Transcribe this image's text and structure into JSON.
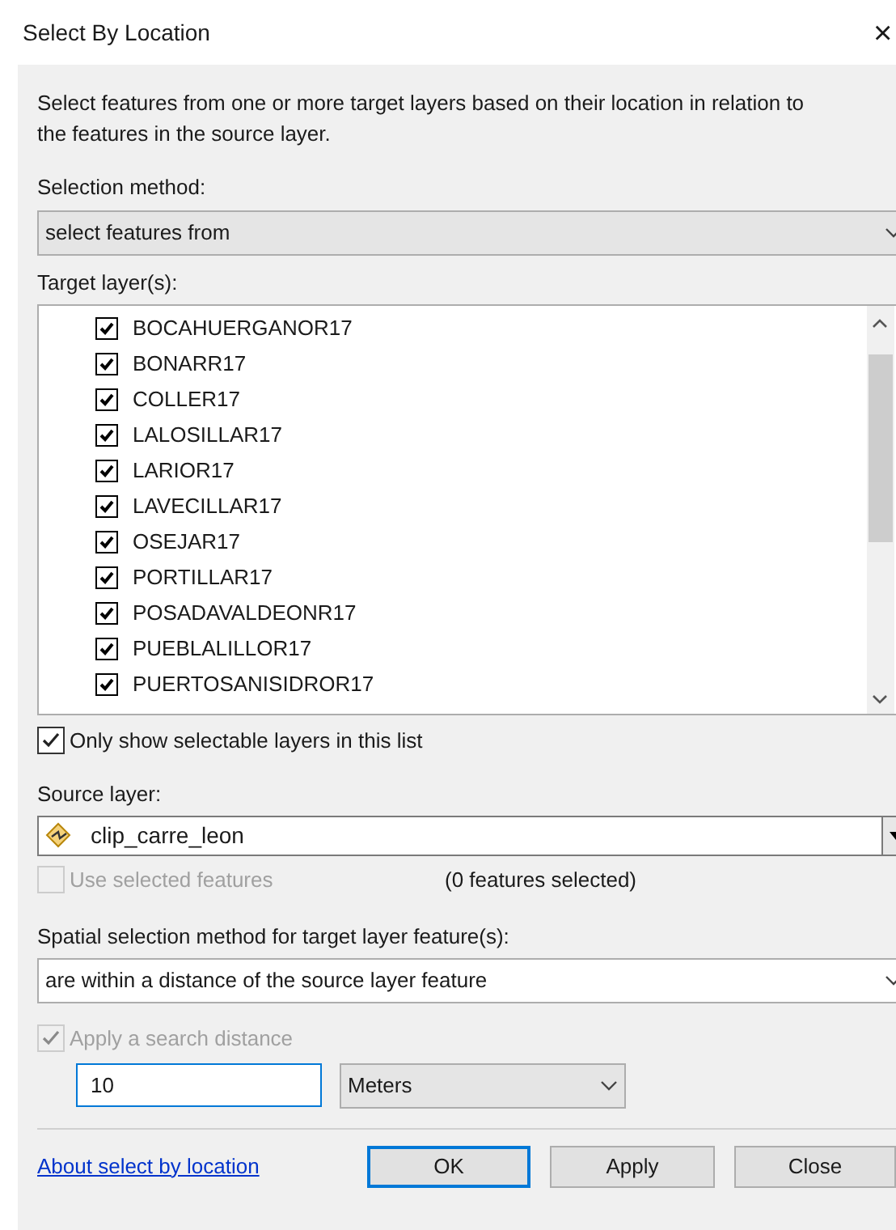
{
  "window": {
    "title": "Select By Location",
    "close": "×"
  },
  "description": "Select features from one or more target layers based on their location in relation to the features in the source layer.",
  "selection_method": {
    "label": "Selection method:",
    "value": "select features from"
  },
  "target_layers": {
    "label": "Target layer(s):",
    "items": [
      {
        "label": "BOCAHUERGANOR17",
        "checked": true
      },
      {
        "label": "BONARR17",
        "checked": true
      },
      {
        "label": "COLLER17",
        "checked": true
      },
      {
        "label": "LALOSILLAR17",
        "checked": true
      },
      {
        "label": "LARIOR17",
        "checked": true
      },
      {
        "label": "LAVECILLAR17",
        "checked": true
      },
      {
        "label": "OSEJAR17",
        "checked": true
      },
      {
        "label": "PORTILLAR17",
        "checked": true
      },
      {
        "label": "POSADAVALDEONR17",
        "checked": true
      },
      {
        "label": "PUEBLALILLOR17",
        "checked": true
      },
      {
        "label": "PUERTOSANISIDROR17",
        "checked": true
      }
    ]
  },
  "only_selectable": {
    "label": "Only show selectable layers in this list",
    "checked": true
  },
  "source_layer": {
    "label": "Source layer:",
    "value": "clip_carre_leon"
  },
  "use_selected": {
    "label": "Use selected features",
    "checked": false,
    "disabled": true,
    "count": "(0 features selected)"
  },
  "spatial_method": {
    "label": "Spatial selection method for target layer feature(s):",
    "value": "are within a distance of the source layer feature"
  },
  "search_distance": {
    "label": "Apply a search distance",
    "checked": true,
    "disabled": true,
    "value": "10",
    "unit": "Meters"
  },
  "help_link": "About select by location",
  "buttons": [
    {
      "label": "OK",
      "default": true
    },
    {
      "label": "Apply",
      "default": false
    },
    {
      "label": "Close",
      "default": false
    }
  ]
}
